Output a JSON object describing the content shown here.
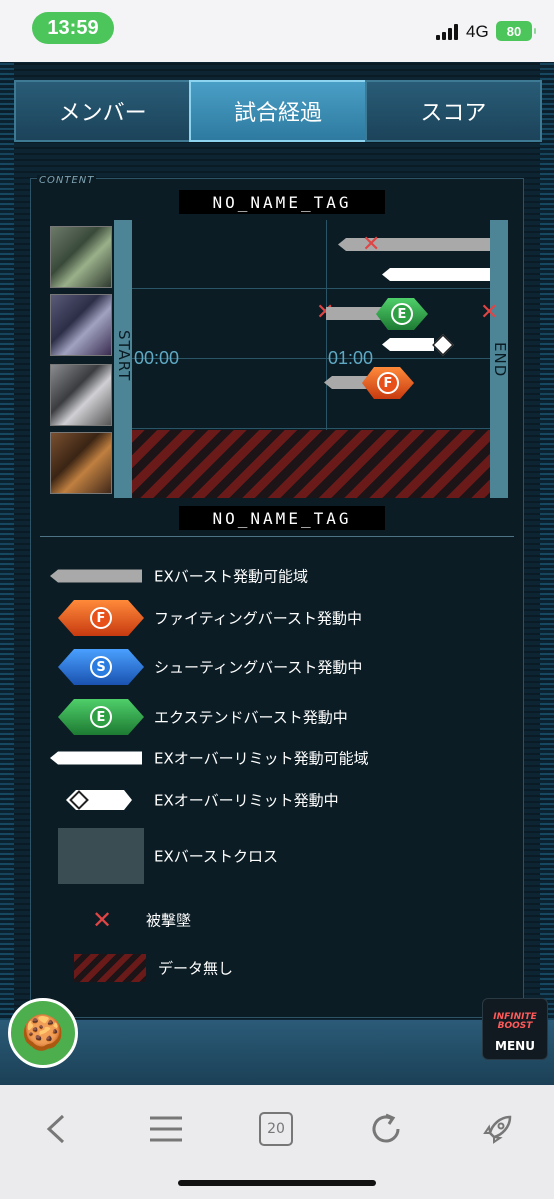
{
  "status_bar": {
    "time": "13:59",
    "network": "4G",
    "battery": "80"
  },
  "tabs": [
    {
      "label": "メンバー",
      "active": false
    },
    {
      "label": "試合経過",
      "active": true
    },
    {
      "label": "スコア",
      "active": false
    }
  ],
  "content": {
    "section_label": "CONTENT",
    "top_tag": "NO_NAME_TAG",
    "bottom_tag": "NO_NAME_TAG",
    "timeline": {
      "start_label": "START",
      "end_label": "END",
      "time_labels": [
        "00:00",
        "01:00"
      ]
    }
  },
  "legend": [
    {
      "icon": "gray-bar-icon",
      "label": "EXバースト発動可能域"
    },
    {
      "icon": "fighting-burst-icon",
      "letter": "F",
      "label": "ファイティングバースト発動中"
    },
    {
      "icon": "shooting-burst-icon",
      "letter": "S",
      "label": "シューティングバースト発動中"
    },
    {
      "icon": "extend-burst-icon",
      "letter": "E",
      "label": "エクステンドバースト発動中"
    },
    {
      "icon": "white-bar-icon",
      "label": "EXオーバーリミット発動可能域"
    },
    {
      "icon": "over-limit-active-icon",
      "label": "EXオーバーリミット発動中"
    },
    {
      "icon": "cross-box-icon",
      "label": "EXバーストクロス"
    },
    {
      "icon": "x-mark-icon",
      "label": "被撃墜"
    },
    {
      "icon": "hatch-icon",
      "label": "データ無し"
    }
  ],
  "floating": {
    "menu_logo": "INFINITE BOOST",
    "menu_label": "MENU"
  },
  "browser": {
    "tab_count": "20"
  },
  "colors": {
    "fighting": "#e8501a",
    "shooting": "#2a7ce0",
    "extend": "#2ea043",
    "downed": "#e04545",
    "active_tab": "#3b8db5"
  }
}
